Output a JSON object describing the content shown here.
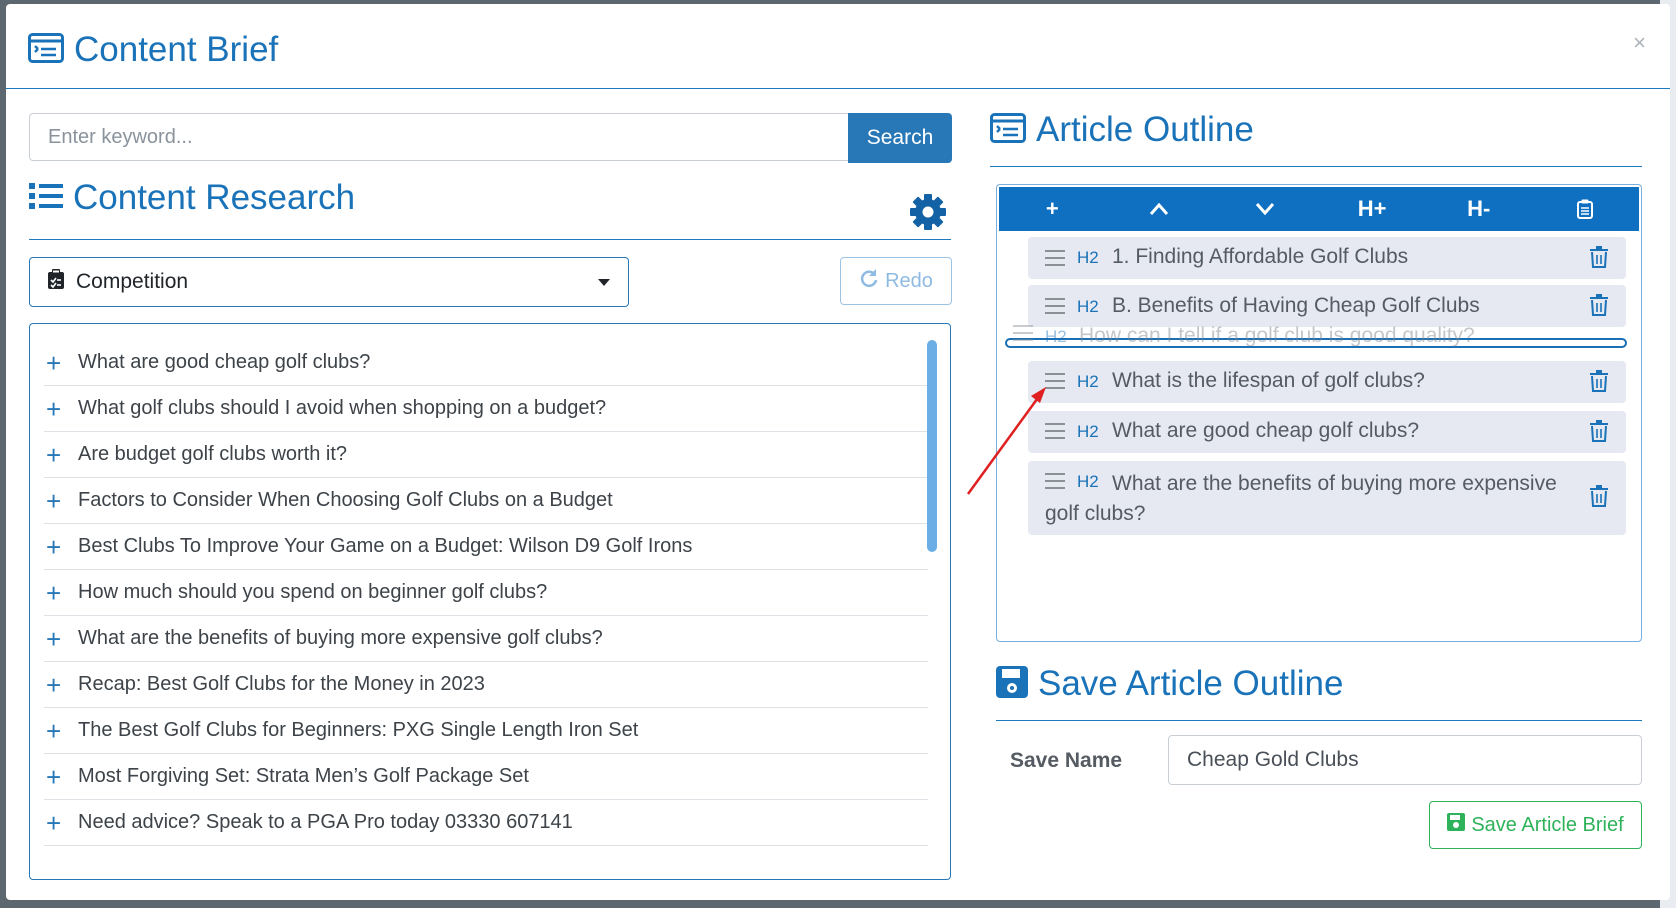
{
  "modal": {
    "title": "Content Brief",
    "close_label": "×"
  },
  "search": {
    "placeholder": "Enter keyword...",
    "button_label": "Search"
  },
  "research": {
    "title": "Content Research",
    "select_value": "Competition",
    "redo_label": "Redo",
    "items": [
      "What are good cheap golf clubs?",
      "What golf clubs should I avoid when shopping on a budget?",
      "Are budget golf clubs worth it?",
      "Factors to Consider When Choosing Golf Clubs on a Budget",
      "Best Clubs To Improve Your Game on a Budget: Wilson D9 Golf Irons",
      "How much should you spend on beginner golf clubs?",
      "What are the benefits of buying more expensive golf clubs?",
      "Recap: Best Golf Clubs for the Money in 2023",
      "The Best Golf Clubs for Beginners: PXG Single Length Iron Set",
      "Most Forgiving Set: Strata Men’s Golf Package Set",
      "Need advice? Speak to a PGA Pro today 03330 607141"
    ]
  },
  "outline": {
    "title": "Article Outline",
    "toolbar": {
      "add": "+",
      "h_plus": "H+",
      "h_minus": "H-"
    },
    "items": [
      {
        "level": "H2",
        "text": "1. Finding Affordable Golf Clubs"
      },
      {
        "level": "H2",
        "text": "B. Benefits of Having Cheap Golf Clubs"
      },
      {
        "level": "H2",
        "text": "What is the lifespan of golf clubs?"
      },
      {
        "level": "H2",
        "text": "What are good cheap golf clubs?"
      },
      {
        "level": "H2",
        "text": "What are the benefits of buying more expensive golf clubs?"
      }
    ],
    "dragging": {
      "level": "H2",
      "text": "How can I tell if a golf club is good quality?"
    }
  },
  "save": {
    "title": "Save Article Outline",
    "name_label": "Save Name",
    "name_value": "Cheap Gold Clubs",
    "button_label": "Save Article Brief"
  },
  "colors": {
    "primary": "#1a73b8",
    "toolbar": "#0f6fc0",
    "success": "#2fb35a",
    "annotation_arrow": "#e02020"
  }
}
